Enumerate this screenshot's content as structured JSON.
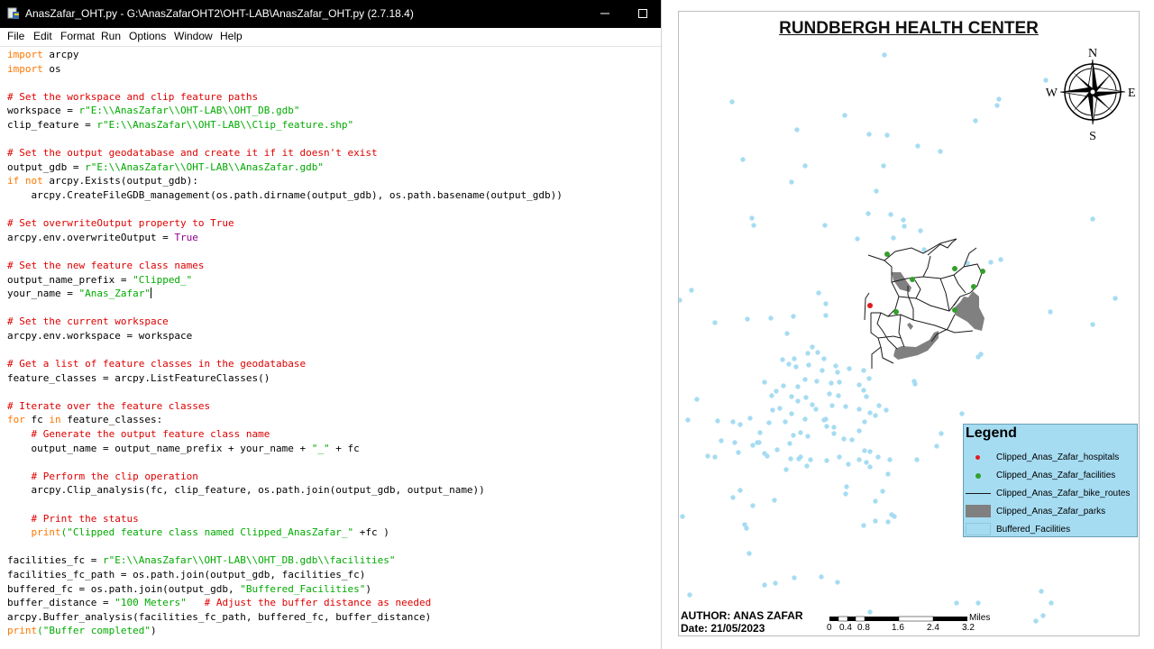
{
  "window": {
    "title": "AnasZafar_OHT.py - G:\\AnasZafarOHT2\\OHT-LAB\\AnasZafar_OHT.py (2.7.18.4)",
    "minimize_icon": "minimize-icon",
    "maximize_icon": "maximize-icon"
  },
  "menu": [
    "File",
    "Edit",
    "Format",
    "Run",
    "Options",
    "Window",
    "Help"
  ],
  "colors": {
    "keyword": "#ff7700",
    "string": "#00aa00",
    "comment": "#dd0000",
    "builtin": "#900090",
    "buffer_point": "#a6dcf2",
    "hospital": "#e31a1c",
    "facility": "#33a02c",
    "park": "#808080",
    "legend_bg": "#a6dcf2"
  },
  "code_lines": [
    [
      [
        "kw",
        "import"
      ],
      [
        "",
        "arcpy"
      ]
    ],
    [
      [
        "kw",
        "import"
      ],
      [
        "",
        "os"
      ]
    ],
    [],
    [
      [
        "cm",
        "# Set the workspace and clip feature paths"
      ]
    ],
    [
      [
        "",
        "workspace = "
      ],
      [
        "st",
        "r\"E:\\\\AnasZafar\\\\OHT-LAB\\\\OHT_DB.gdb\""
      ]
    ],
    [
      [
        "",
        "clip_feature = "
      ],
      [
        "st",
        "r\"E:\\\\AnasZafar\\\\OHT-LAB\\\\Clip_feature.shp\""
      ]
    ],
    [],
    [
      [
        "cm",
        "# Set the output geodatabase and create it if it doesn't exist"
      ]
    ],
    [
      [
        "",
        "output_gdb = "
      ],
      [
        "st",
        "r\"E:\\\\AnasZafar\\\\OHT-LAB\\\\AnasZafar.gdb\""
      ]
    ],
    [
      [
        "kw",
        "if not"
      ],
      [
        "",
        "arcpy.Exists(output_gdb):"
      ]
    ],
    [
      [
        "",
        "    arcpy.CreateFileGDB_management(os.path.dirname(output_gdb), os.path.basename(output_gdb))"
      ]
    ],
    [],
    [
      [
        "cm",
        "# Set overwriteOutput property to True"
      ]
    ],
    [
      [
        "",
        "arcpy.env.overwriteOutput = "
      ],
      [
        "bi",
        "True"
      ]
    ],
    [],
    [
      [
        "cm",
        "# Set the new feature class names"
      ]
    ],
    [
      [
        "",
        "output_name_prefix = "
      ],
      [
        "st",
        "\"Clipped_\""
      ]
    ],
    [
      [
        "",
        "your_name = "
      ],
      [
        "st",
        "\"Anas_Zafar\""
      ],
      [
        "caret",
        ""
      ]
    ],
    [],
    [
      [
        "cm",
        "# Set the current workspace"
      ]
    ],
    [
      [
        "",
        "arcpy.env.workspace = workspace"
      ]
    ],
    [],
    [
      [
        "cm",
        "# Get a list of feature classes in the geodatabase"
      ]
    ],
    [
      [
        "",
        "feature_classes = arcpy.ListFeatureClasses()"
      ]
    ],
    [],
    [
      [
        "cm",
        "# Iterate over the feature classes"
      ]
    ],
    [
      [
        "kw",
        "for"
      ],
      [
        "",
        "fc "
      ],
      [
        "kw",
        "in"
      ],
      [
        "",
        "feature_classes:"
      ]
    ],
    [
      [
        "",
        "    "
      ],
      [
        "cm",
        "# Generate the output feature class name"
      ]
    ],
    [
      [
        "",
        "    output_name = output_name_prefix + your_name + "
      ],
      [
        "st",
        "\"_\""
      ],
      [
        "",
        "+ fc"
      ]
    ],
    [],
    [
      [
        "",
        "    "
      ],
      [
        "cm",
        "# Perform the clip operation"
      ]
    ],
    [
      [
        "",
        "    arcpy.Clip_analysis(fc, clip_feature, os.path.join(output_gdb, output_name))"
      ]
    ],
    [],
    [
      [
        "",
        "    "
      ],
      [
        "cm",
        "# Print the status"
      ]
    ],
    [
      [
        "",
        "    "
      ],
      [
        "kw",
        "print"
      ],
      [
        "st",
        "(\"Clipped feature class named Clipped_AnasZafar_\""
      ],
      [
        "",
        "+fc )"
      ]
    ],
    [],
    [
      [
        "",
        "facilities_fc = "
      ],
      [
        "st",
        "r\"E:\\\\AnasZafar\\\\OHT-LAB\\\\OHT_DB.gdb\\\\facilities\""
      ]
    ],
    [
      [
        "",
        "facilities_fc_path = os.path.join(output_gdb, facilities_fc)"
      ]
    ],
    [
      [
        "",
        "buffered_fc = os.path.join(output_gdb, "
      ],
      [
        "st",
        "\"Buffered_Facilities\""
      ],
      [
        "",
        ")"
      ]
    ],
    [
      [
        "",
        "buffer_distance = "
      ],
      [
        "st",
        "\"100 Meters\""
      ],
      [
        "",
        "  "
      ],
      [
        "cm",
        "# Adjust the buffer distance as needed"
      ]
    ],
    [
      [
        "",
        "arcpy.Buffer_analysis(facilities_fc_path, buffered_fc, buffer_distance)"
      ]
    ],
    [
      [
        "kw",
        "print"
      ],
      [
        "st",
        "(\"Buffer completed\""
      ],
      [
        "",
        ")"
      ]
    ]
  ],
  "map": {
    "title": "RUNDBERGH HEALTH CENTER",
    "compass": {
      "n": "N",
      "s": "S",
      "e": "E",
      "w": "W",
      "icon": "compass-rose-icon"
    },
    "legend": {
      "title": "Legend",
      "items": [
        {
          "label": "Clipped_Anas_Zafar_hospitals",
          "symbol": "red-dot"
        },
        {
          "label": "Clipped_Anas_Zafar_facilities",
          "symbol": "green-dot"
        },
        {
          "label": "Clipped_Anas_Zafar_bike_routes",
          "symbol": "line"
        },
        {
          "label": "Clipped_Anas_Zafar_parks",
          "symbol": "gray-fill"
        },
        {
          "label": "Buffered_Facilities",
          "symbol": "blue-fill"
        }
      ]
    },
    "author": "AUTHOR: ANAS ZAFAR",
    "date": "Date: 21/05/2023",
    "scale": {
      "ticks": [
        "0",
        "0.4",
        "0.8",
        "1.6",
        "2.4",
        "3.2"
      ],
      "unit": "Miles"
    }
  }
}
